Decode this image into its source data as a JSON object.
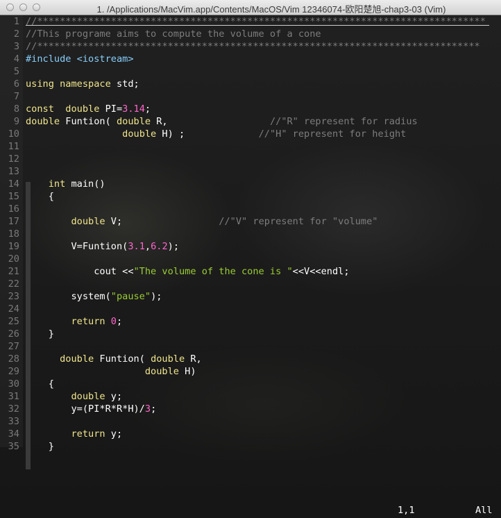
{
  "window": {
    "title": "1. /Applications/MacVim.app/Contents/MacOS/Vim 12346074-欧阳楚旭-chap3-03 (Vim)"
  },
  "colors": {
    "comment": "#7d7d7d",
    "preprocessor": "#87cefa",
    "keyword": "#f0e68c",
    "number": "#ff66cc",
    "string": "#9acd32",
    "text": "#ffffff",
    "line_number": "#7a7a7a"
  },
  "lines": [
    {
      "n": "1",
      "segs": [
        {
          "t": "//*******************************************************************************",
          "c": "cmt"
        }
      ]
    },
    {
      "n": "2",
      "segs": [
        {
          "t": "//This programe aims to compute the volume of a cone",
          "c": "cmt"
        }
      ]
    },
    {
      "n": "3",
      "segs": [
        {
          "t": "//******************************************************************************",
          "c": "cmt"
        }
      ]
    },
    {
      "n": "4",
      "segs": [
        {
          "t": "#include <iostream>",
          "c": "pp"
        }
      ]
    },
    {
      "n": "5",
      "segs": []
    },
    {
      "n": "6",
      "segs": [
        {
          "t": "using namespace",
          "c": "kw"
        },
        {
          "t": " std;",
          "c": "pl"
        }
      ]
    },
    {
      "n": "7",
      "segs": []
    },
    {
      "n": "8",
      "segs": [
        {
          "t": "const  double",
          "c": "kw"
        },
        {
          "t": " PI=",
          "c": "pl"
        },
        {
          "t": "3.14",
          "c": "num"
        },
        {
          "t": ";",
          "c": "pl"
        }
      ]
    },
    {
      "n": "9",
      "segs": [
        {
          "t": "double",
          "c": "kw"
        },
        {
          "t": " Funtion( ",
          "c": "pl"
        },
        {
          "t": "double",
          "c": "kw"
        },
        {
          "t": " R,                  ",
          "c": "pl"
        },
        {
          "t": "//\"R\" represent for radius",
          "c": "cmt"
        }
      ]
    },
    {
      "n": "10",
      "segs": [
        {
          "t": "                 ",
          "c": "pl"
        },
        {
          "t": "double",
          "c": "kw"
        },
        {
          "t": " H) ;             ",
          "c": "pl"
        },
        {
          "t": "//\"H\" represent for height",
          "c": "cmt"
        }
      ]
    },
    {
      "n": "11",
      "segs": []
    },
    {
      "n": "12",
      "segs": []
    },
    {
      "n": "13",
      "segs": []
    },
    {
      "n": "14",
      "segs": [
        {
          "t": "    ",
          "c": "pl"
        },
        {
          "t": "int",
          "c": "kw"
        },
        {
          "t": " main()",
          "c": "pl"
        }
      ]
    },
    {
      "n": "15",
      "segs": [
        {
          "t": "    {",
          "c": "pl"
        }
      ]
    },
    {
      "n": "16",
      "segs": []
    },
    {
      "n": "17",
      "segs": [
        {
          "t": "        ",
          "c": "pl"
        },
        {
          "t": "double",
          "c": "kw"
        },
        {
          "t": " V;                 ",
          "c": "pl"
        },
        {
          "t": "//\"V\" represent for \"volume\"",
          "c": "cmt"
        }
      ]
    },
    {
      "n": "18",
      "segs": []
    },
    {
      "n": "19",
      "segs": [
        {
          "t": "        V=Funtion(",
          "c": "pl"
        },
        {
          "t": "3.1",
          "c": "num"
        },
        {
          "t": ",",
          "c": "pl"
        },
        {
          "t": "6.2",
          "c": "num"
        },
        {
          "t": ");",
          "c": "pl"
        }
      ]
    },
    {
      "n": "20",
      "segs": []
    },
    {
      "n": "21",
      "segs": [
        {
          "t": "            cout <<",
          "c": "pl"
        },
        {
          "t": "\"The volume of the cone is \"",
          "c": "str"
        },
        {
          "t": "<<V<<endl;",
          "c": "pl"
        }
      ]
    },
    {
      "n": "22",
      "segs": []
    },
    {
      "n": "23",
      "segs": [
        {
          "t": "        system(",
          "c": "pl"
        },
        {
          "t": "\"pause\"",
          "c": "str"
        },
        {
          "t": ");",
          "c": "pl"
        }
      ]
    },
    {
      "n": "24",
      "segs": []
    },
    {
      "n": "25",
      "segs": [
        {
          "t": "        ",
          "c": "pl"
        },
        {
          "t": "return",
          "c": "kw"
        },
        {
          "t": " ",
          "c": "pl"
        },
        {
          "t": "0",
          "c": "num"
        },
        {
          "t": ";",
          "c": "pl"
        }
      ]
    },
    {
      "n": "26",
      "segs": [
        {
          "t": "    }",
          "c": "pl"
        }
      ]
    },
    {
      "n": "27",
      "segs": []
    },
    {
      "n": "28",
      "segs": [
        {
          "t": "      ",
          "c": "pl"
        },
        {
          "t": "double",
          "c": "kw"
        },
        {
          "t": " Funtion( ",
          "c": "pl"
        },
        {
          "t": "double",
          "c": "kw"
        },
        {
          "t": " R,",
          "c": "pl"
        }
      ]
    },
    {
      "n": "29",
      "segs": [
        {
          "t": "                     ",
          "c": "pl"
        },
        {
          "t": "double",
          "c": "kw"
        },
        {
          "t": " H)",
          "c": "pl"
        }
      ]
    },
    {
      "n": "30",
      "segs": [
        {
          "t": "    {",
          "c": "pl"
        }
      ]
    },
    {
      "n": "31",
      "segs": [
        {
          "t": "        ",
          "c": "pl"
        },
        {
          "t": "double",
          "c": "kw"
        },
        {
          "t": " y;",
          "c": "pl"
        }
      ]
    },
    {
      "n": "32",
      "segs": [
        {
          "t": "        y=(PI*R*R*H)/",
          "c": "pl"
        },
        {
          "t": "3",
          "c": "num"
        },
        {
          "t": ";",
          "c": "pl"
        }
      ]
    },
    {
      "n": "33",
      "segs": []
    },
    {
      "n": "34",
      "segs": [
        {
          "t": "        ",
          "c": "pl"
        },
        {
          "t": "return",
          "c": "kw"
        },
        {
          "t": " y;",
          "c": "pl"
        }
      ]
    },
    {
      "n": "35",
      "segs": [
        {
          "t": "    }",
          "c": "pl"
        }
      ]
    }
  ],
  "status": {
    "position": "1,1",
    "scroll": "All"
  }
}
